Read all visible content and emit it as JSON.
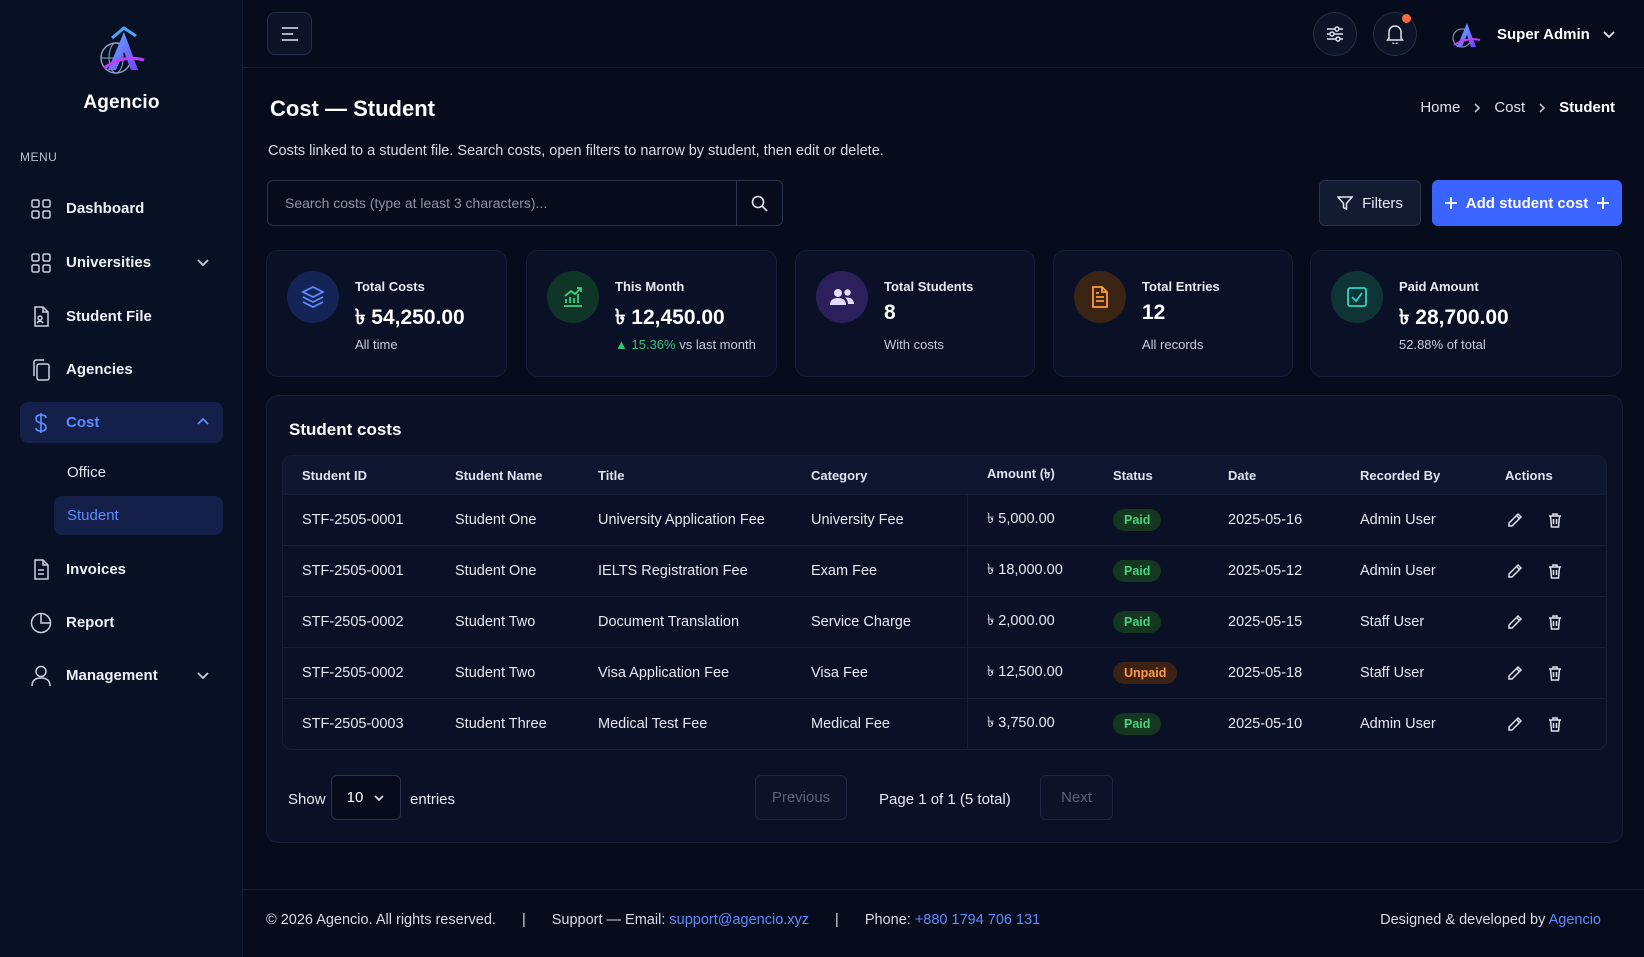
{
  "brand": {
    "name": "Agencio"
  },
  "sidebar": {
    "menu_label": "MENU",
    "items": [
      {
        "label": "Dashboard",
        "icon": "grid-icon"
      },
      {
        "label": "Universities",
        "icon": "grid-icon"
      },
      {
        "label": "Student File",
        "icon": "file-icon"
      },
      {
        "label": "Agencies",
        "icon": "copy-icon"
      },
      {
        "label": "Cost",
        "icon": "dollar-icon"
      },
      {
        "label": "Invoices",
        "icon": "invoice-icon"
      },
      {
        "label": "Report",
        "icon": "pie-chart-icon"
      },
      {
        "label": "Management",
        "icon": "user-icon"
      }
    ],
    "cost_sub": [
      "Office",
      "Student"
    ]
  },
  "topbar": {
    "user_name": "Super Admin"
  },
  "page": {
    "title": "Cost — Student",
    "subtitle": "Costs linked to a student file. Search costs, open filters to narrow by student, then edit or delete.",
    "breadcrumb": [
      "Home",
      "Cost",
      "Student"
    ]
  },
  "search": {
    "placeholder": "Search costs (type at least 3 characters)...",
    "value": ""
  },
  "buttons": {
    "filters": "Filters",
    "add": "Add student cost"
  },
  "stats": [
    {
      "label": "Total Costs",
      "value": "৳ 54,250.00",
      "note": "All time",
      "color": "#3a63ff",
      "bg": "#142456"
    },
    {
      "label": "This Month",
      "value": "৳ 12,450.00",
      "trend": "15.36%",
      "note": "vs last month",
      "color": "#3fd07d",
      "bg": "#0f3526"
    },
    {
      "label": "Total Students",
      "value": "8",
      "note": "With costs",
      "color": "#b089ff",
      "bg": "#2b1f5c"
    },
    {
      "label": "Total Entries",
      "value": "12",
      "note": "All records",
      "color": "#ff9a3c",
      "bg": "#3a2414"
    },
    {
      "label": "Paid Amount",
      "value": "৳ 28,700.00",
      "note": "52.88% of total",
      "color": "#2fd6c8",
      "bg": "#0f3436"
    }
  ],
  "table": {
    "title": "Student costs",
    "columns": [
      "Student ID",
      "Student Name",
      "Title",
      "Category",
      "Amount (৳)",
      "Status",
      "Date",
      "Recorded By",
      "Actions"
    ],
    "rows": [
      {
        "id": "STF-2505-0001",
        "name": "Student One",
        "title": "University Application Fee",
        "category": "University Fee",
        "amount": "৳ 5,000.00",
        "status": "Paid",
        "date": "2025-05-16",
        "by": "Admin User"
      },
      {
        "id": "STF-2505-0001",
        "name": "Student One",
        "title": "IELTS Registration Fee",
        "category": "Exam Fee",
        "amount": "৳ 18,000.00",
        "status": "Paid",
        "date": "2025-05-12",
        "by": "Admin User"
      },
      {
        "id": "STF-2505-0002",
        "name": "Student Two",
        "title": "Document Translation",
        "category": "Service Charge",
        "amount": "৳ 2,000.00",
        "status": "Paid",
        "date": "2025-05-15",
        "by": "Staff User"
      },
      {
        "id": "STF-2505-0002",
        "name": "Student Two",
        "title": "Visa Application Fee",
        "category": "Visa Fee",
        "amount": "৳ 12,500.00",
        "status": "Unpaid",
        "date": "2025-05-18",
        "by": "Staff User"
      },
      {
        "id": "STF-2505-0003",
        "name": "Student Three",
        "title": "Medical Test Fee",
        "category": "Medical Fee",
        "amount": "৳ 3,750.00",
        "status": "Paid",
        "date": "2025-05-10",
        "by": "Admin User"
      }
    ]
  },
  "pagination": {
    "show": "Show",
    "page_size": "10",
    "entries": "entries",
    "previous": "Previous",
    "info": "Page 1 of 1 (5 total)",
    "next": "Next"
  },
  "footer": {
    "copyright": "© 2026 Agencio. All rights reserved.",
    "support_label": "Support — Email:",
    "email": "support@agencio.xyz",
    "phone_label": "Phone:",
    "phone": "+880 1794 706 131",
    "credit": "Designed & developed by",
    "credit_link": "Agencio"
  },
  "colors": {
    "accent": "#3a63ff",
    "active_text": "#5b8cff",
    "paid": "#45d57d",
    "unpaid": "#ff9a4c"
  }
}
